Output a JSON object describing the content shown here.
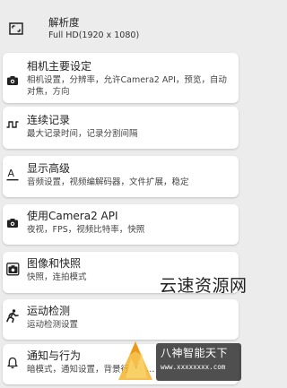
{
  "resolution": {
    "title": "解析度",
    "value": "Full HD(1920 x 1080)",
    "icon": "aspect-ratio-icon"
  },
  "settings": [
    {
      "title": "相机主要设定",
      "desc": "相机设置，分辨率，允许Camera2 API，预览，自动对焦，方向",
      "icon": "camera-icon"
    },
    {
      "title": "连续记录",
      "desc": "最大记录时间，记录分割间隔",
      "icon": "pulse-wave-icon"
    },
    {
      "title": "显示高级",
      "desc": "音频设置，视频编解码器，文件扩展，稳定",
      "icon": "text-format-icon"
    },
    {
      "title": "使用Camera2 API",
      "desc": "夜视，FPS，视频比特率，快照",
      "icon": "camera-icon"
    },
    {
      "title": "图像和快照",
      "desc": "快照，连拍模式",
      "icon": "camera-burst-icon"
    },
    {
      "title": "运动检测",
      "desc": "运动检测设置",
      "icon": "running-person-icon"
    },
    {
      "title": "通知与行为",
      "desc": "暗模式，通知设置，背景行为，…",
      "icon": "bell-icon"
    }
  ],
  "watermark": {
    "site_text": "云速资源网",
    "brand_name": "八神智能天下",
    "brand_url": "www.xxxxxxxx.com"
  }
}
